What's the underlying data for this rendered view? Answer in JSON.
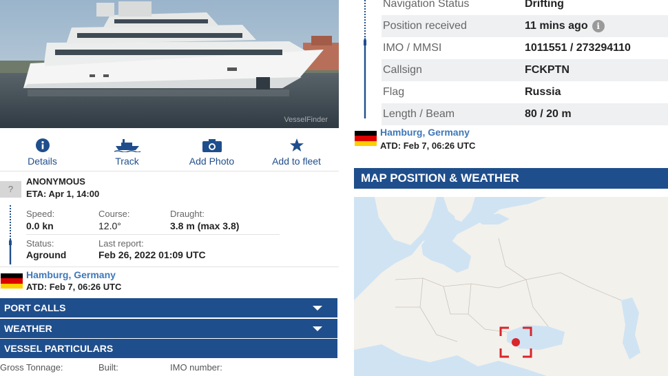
{
  "photo": {
    "watermark": "VesselFinder"
  },
  "actions": [
    {
      "label": "Details",
      "icon": "info-icon"
    },
    {
      "label": "Track",
      "icon": "ship-icon"
    },
    {
      "label": "Add Photo",
      "icon": "camera-icon"
    },
    {
      "label": "Add to fleet",
      "icon": "star-icon"
    }
  ],
  "destination": {
    "unknown_symbol": "?",
    "name": "ANONYMOUS",
    "eta": "ETA: Apr 1, 14:00"
  },
  "voyage": {
    "speed_label": "Speed:",
    "speed": "0.0 kn",
    "course_label": "Course:",
    "course": "12.0°",
    "draught_label": "Draught:",
    "draught": "3.8 m (max 3.8)",
    "status_label": "Status:",
    "status": "Aground",
    "last_report_label": "Last report:",
    "last_report": "Feb 26, 2022 01:09 UTC"
  },
  "departure": {
    "port": "Hamburg, Germany",
    "atd": "ATD: Feb 7, 06:26 UTC",
    "flag_colors": [
      "#000000",
      "#dd0000",
      "#ffce00"
    ]
  },
  "sections": {
    "port_calls": "PORT CALLS",
    "weather": "WEATHER",
    "vessel_particulars": "VESSEL PARTICULARS"
  },
  "particulars": {
    "gross_tonnage_label": "Gross Tonnage:",
    "built_label": "Built:",
    "imo_label": "IMO number:"
  },
  "details_table": [
    {
      "label": "Navigation Status",
      "value": "Drifting"
    },
    {
      "label": "Position received",
      "value": "11 mins ago"
    },
    {
      "label": "IMO / MMSI",
      "value": "1011551 / 273294110"
    },
    {
      "label": "Callsign",
      "value": "FCKPTN"
    },
    {
      "label": "Flag",
      "value": "Russia"
    },
    {
      "label": "Length / Beam",
      "value": "80 / 20 m"
    }
  ],
  "info_symbol": "i",
  "map": {
    "title": "MAP POSITION & WEATHER",
    "water_color": "#cfe3f3",
    "land_color": "#f3f1ec",
    "marker_color": "#d9252b"
  },
  "colors": {
    "accent": "#1f4e8c",
    "link": "#3d77b8"
  }
}
